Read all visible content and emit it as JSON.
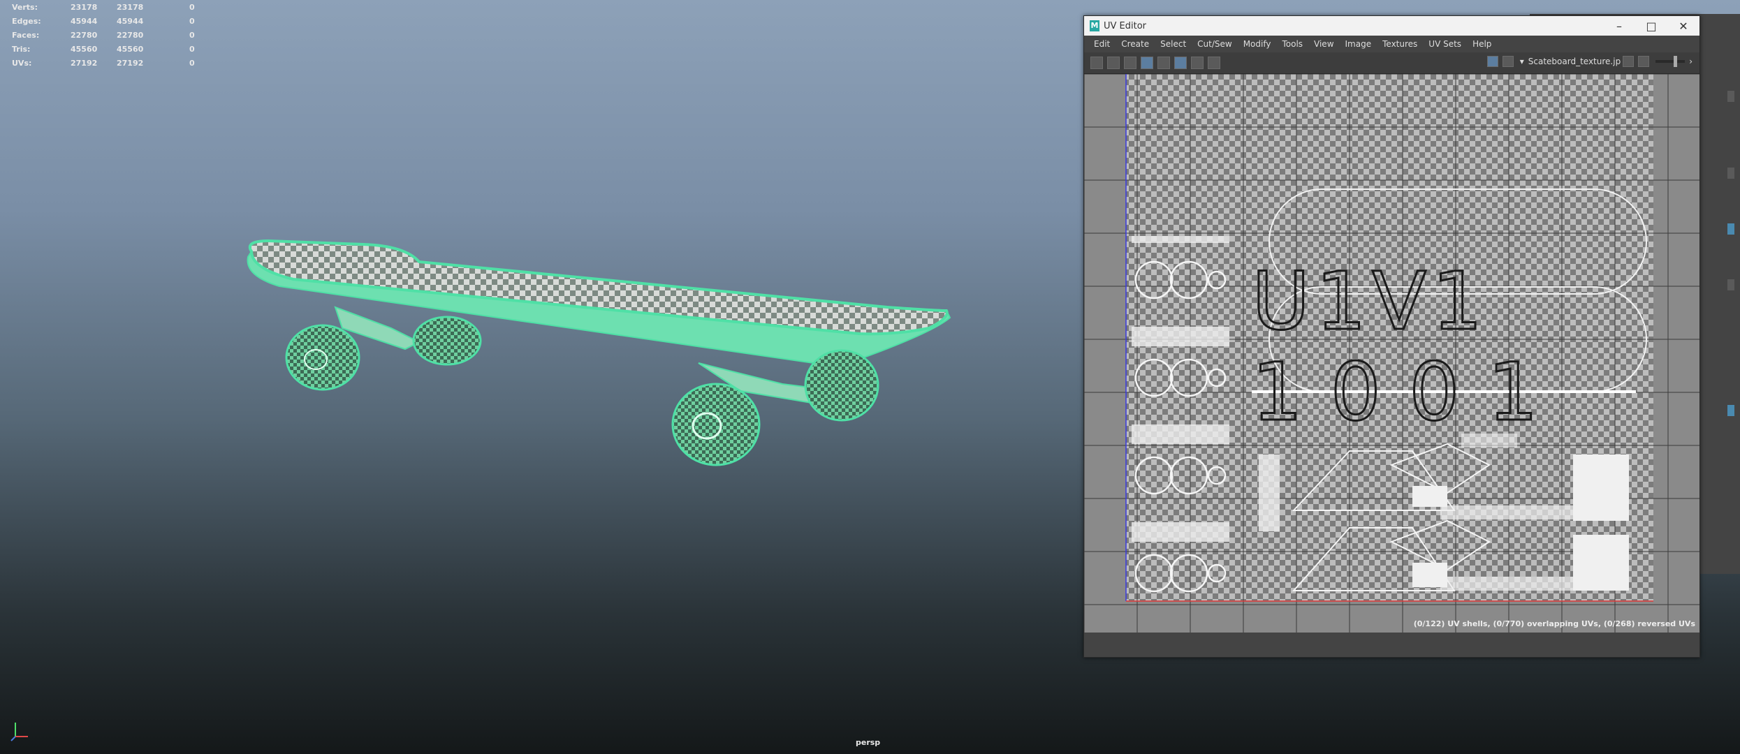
{
  "hud": {
    "rows": [
      {
        "label": "Verts:",
        "a": "23178",
        "b": "23178",
        "c": "0"
      },
      {
        "label": "Edges:",
        "a": "45944",
        "b": "45944",
        "c": "0"
      },
      {
        "label": "Faces:",
        "a": "22780",
        "b": "22780",
        "c": "0"
      },
      {
        "label": "Tris:",
        "a": "45560",
        "b": "45560",
        "c": "0"
      },
      {
        "label": "UVs:",
        "a": "27192",
        "b": "27192",
        "c": "0"
      }
    ]
  },
  "viewport": {
    "camera_label": "persp"
  },
  "uv_editor": {
    "title": "UV Editor",
    "menu": [
      "Edit",
      "Create",
      "Select",
      "Cut/Sew",
      "Modify",
      "Tools",
      "View",
      "Image",
      "Textures",
      "UV Sets",
      "Help"
    ],
    "texture_name": "Scateboard_texture.jp",
    "tile_labels": [
      "U1V1",
      "1001"
    ],
    "status": "(0/122) UV shells, (0/770) overlapping UVs, (0/268) reversed UVs"
  },
  "colors": {
    "wire": "#4fe0a6",
    "accent": "#27a8a3"
  }
}
